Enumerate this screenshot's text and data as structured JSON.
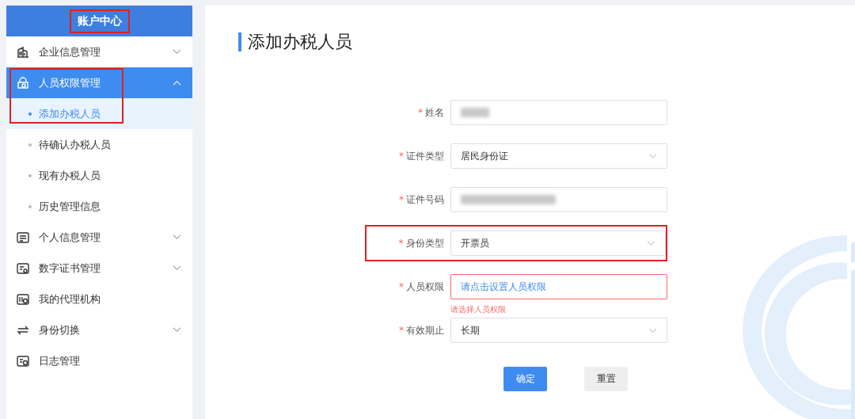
{
  "sidebar": {
    "title": "账户中心",
    "title_highlighted": true,
    "items": [
      {
        "label": "企业信息管理",
        "expanded": false,
        "selected": false,
        "highlighted": false
      },
      {
        "label": "人员权限管理",
        "expanded": true,
        "selected": true,
        "highlighted": true,
        "children": [
          {
            "label": "添加办税人员",
            "selected": true
          },
          {
            "label": "待确认办税人员",
            "selected": false
          },
          {
            "label": "现有办税人员",
            "selected": false
          },
          {
            "label": "历史管理信息",
            "selected": false
          }
        ]
      },
      {
        "label": "个人信息管理",
        "expanded": false,
        "selected": false,
        "highlighted": false
      },
      {
        "label": "数字证书管理",
        "expanded": false,
        "selected": false,
        "highlighted": false
      },
      {
        "label": "我的代理机构",
        "selected": false,
        "highlighted": false
      },
      {
        "label": "身份切换",
        "expanded": false,
        "selected": false,
        "highlighted": false
      },
      {
        "label": "日志管理",
        "selected": false,
        "highlighted": false
      }
    ]
  },
  "page": {
    "title": "添加办税人员",
    "fields": [
      {
        "label": "姓名",
        "required_mark": "*",
        "kind": "redacted",
        "highlighted": false
      },
      {
        "label": "证件类型",
        "required_mark": "*",
        "kind": "select",
        "value": "居民身份证",
        "highlighted": false
      },
      {
        "label": "证件号码",
        "required_mark": "*",
        "kind": "redacted",
        "highlighted": false
      },
      {
        "label": "身份类型",
        "required_mark": "*",
        "kind": "select",
        "value": "开票员",
        "highlighted": true
      },
      {
        "label": "人员权限",
        "required_mark": "*",
        "kind": "picker",
        "placeholder": "请点击设置人员权限",
        "error": "请选择人员权限",
        "highlighted": false
      },
      {
        "label": "有效期止",
        "required_mark": "*",
        "kind": "select",
        "value": "长期",
        "highlighted": false
      }
    ],
    "buttons": [
      {
        "label": "确定",
        "primary": true
      },
      {
        "label": "重置",
        "primary": false
      }
    ]
  }
}
